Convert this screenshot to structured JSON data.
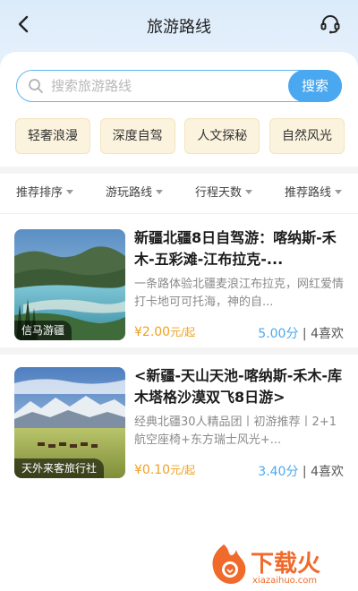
{
  "header": {
    "title": "旅游路线",
    "back_icon": "chevron-left-icon",
    "service_icon": "headset-icon"
  },
  "search": {
    "placeholder": "搜索旅游路线",
    "button_label": "搜索"
  },
  "tags": [
    "轻奢浪漫",
    "深度自驾",
    "人文探秘",
    "自然风光"
  ],
  "filters": [
    "推荐排序",
    "游玩路线",
    "行程天数",
    "推荐路线"
  ],
  "routes": [
    {
      "title": "新疆北疆8日自驾游：喀纳斯-禾木-五彩滩-江布拉克-...",
      "description": "一条路体验北疆麦浪江布拉克，网红爱情打卡地可可托海，神的自...",
      "agency": "信马游疆",
      "price": "¥2.00",
      "price_unit": "元/起",
      "score": "5.00分",
      "likes": "4喜欢"
    },
    {
      "title": "<新疆-天山天池-喀纳斯-禾木-库木塔格沙漠双飞8日游>",
      "description": "经典北疆30人精品团丨初游推荐丨2+1航空座椅+东方瑞士风光+...",
      "agency": "天外来客旅行社",
      "price": "¥0.10",
      "price_unit": "元/起",
      "score": "3.40分",
      "likes": "4喜欢"
    }
  ],
  "watermark": {
    "text": "下载火",
    "subtext": "xiazaihuo.com"
  },
  "colors": {
    "accent": "#4aa8f0",
    "price": "#f0a020",
    "tag_bg": "#fbf3de",
    "watermark": "#f06a2c"
  }
}
